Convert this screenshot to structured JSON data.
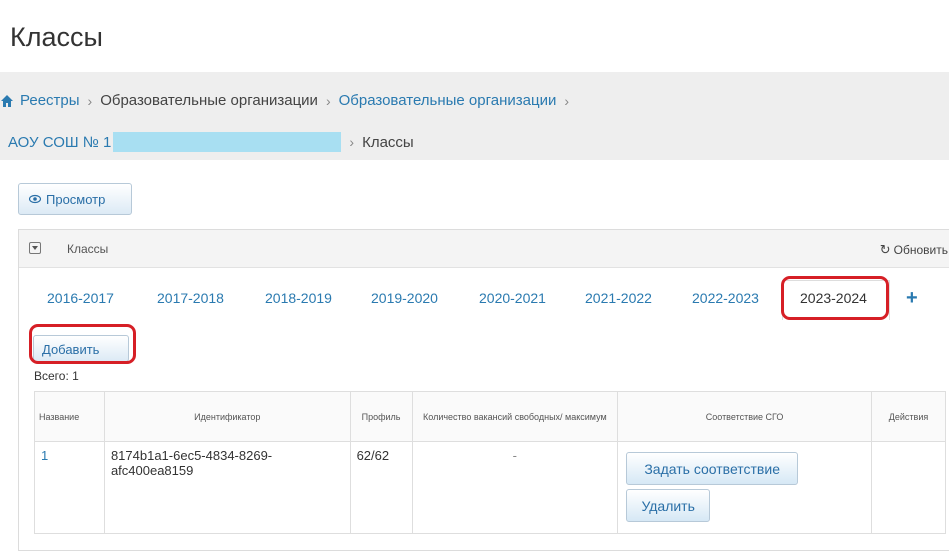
{
  "page": {
    "title": "Классы"
  },
  "breadcrumb": {
    "items": [
      "Реестры",
      "Образовательные организации",
      "Образовательные организации"
    ],
    "org": "АОУ СОШ № 1",
    "current": "Классы"
  },
  "toolbar": {
    "view_label": "Просмотр"
  },
  "panel": {
    "title": "Классы",
    "refresh_label": "Обновить"
  },
  "tabs": [
    {
      "label": "2016-2017"
    },
    {
      "label": "2017-2018"
    },
    {
      "label": "2018-2019"
    },
    {
      "label": "2019-2020"
    },
    {
      "label": "2020-2021"
    },
    {
      "label": "2021-2022"
    },
    {
      "label": "2022-2023"
    },
    {
      "label": "2023-2024"
    }
  ],
  "active_tab": "2023-2024",
  "add_label": "Добавить",
  "total": "Всего: 1",
  "table": {
    "headers": [
      "Название",
      "Идентификатор",
      "Профиль",
      "Количество вакансий свободных/ максимум",
      "Соответствие СГО",
      "Действия"
    ],
    "rows": [
      {
        "name": "1",
        "id": "8174b1a1-6ec5-4834-8269-afc400ea8159",
        "profile": "62/62",
        "vacancies": "-",
        "set_match_label": "Задать соответствие",
        "delete_label": "Удалить",
        "actions": ""
      }
    ]
  },
  "colors": {
    "link": "#2a7ab0",
    "highlight": "#d61f26",
    "redaction": "#a8dff2"
  },
  "icons": {
    "home": "home-icon",
    "view": "eye-icon",
    "collapse": "collapse-icon",
    "refresh": "refresh-icon",
    "add_tab": "plus-icon"
  }
}
